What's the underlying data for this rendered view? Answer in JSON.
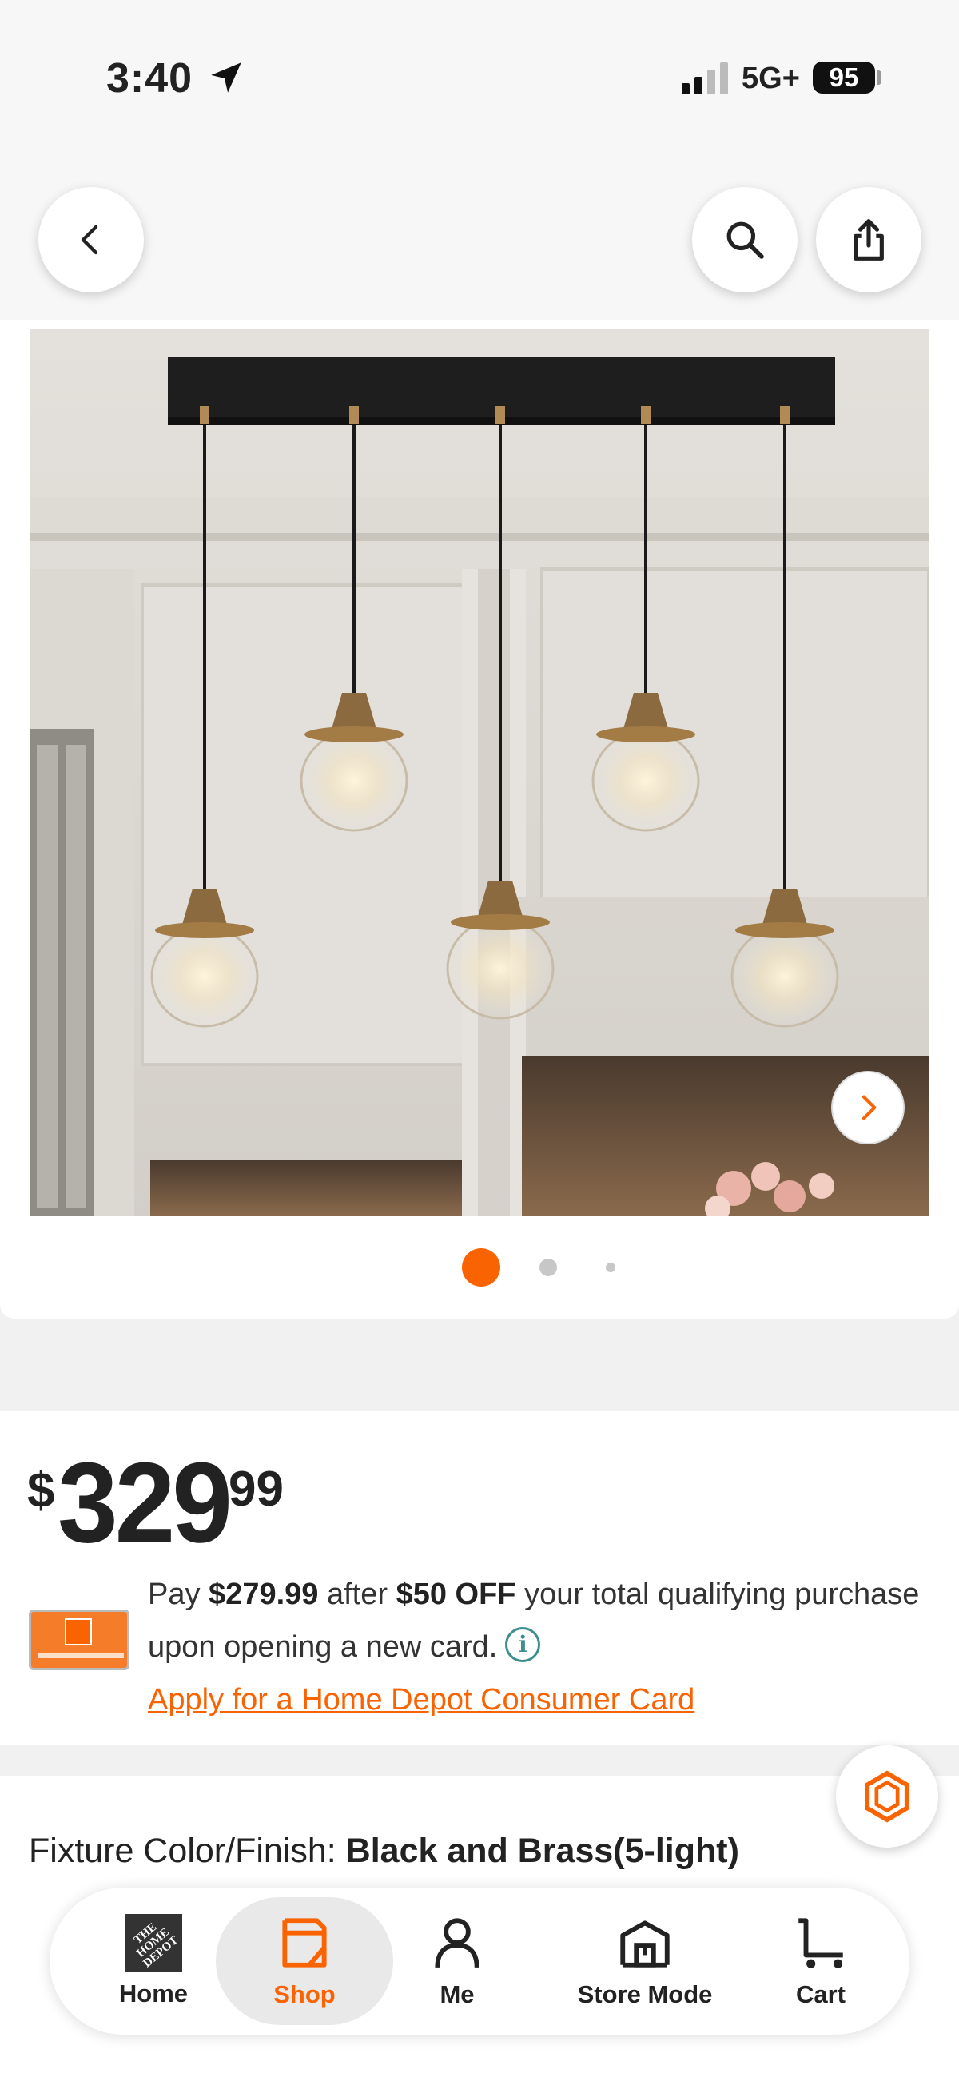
{
  "status_bar": {
    "time": "3:40",
    "network": "5G+",
    "battery": "95",
    "icons": [
      "location-arrow-icon",
      "signal-bars-icon",
      "battery-icon"
    ]
  },
  "top_nav": {
    "icons": [
      "chevron-left-icon",
      "search-icon",
      "share-icon"
    ]
  },
  "gallery": {
    "image_alt": "Black and brass 5-light pendant chandelier with clear glass globes",
    "next_icon": "chevron-right-icon",
    "slide_count": 3,
    "active_slide": 1
  },
  "price": {
    "dollar_sign": "$",
    "whole": "329",
    "cents": "99"
  },
  "promo": {
    "text_pay": "Pay ",
    "sale_price": "$279.99",
    "text_after": " after ",
    "discount": "$50 OFF",
    "text_rest": " your total qualifying purchase upon opening a new card.",
    "info_glyph": "i",
    "apply_link": "Apply for a Home Depot Consumer Card"
  },
  "fixture": {
    "label": "Fixture Color/Finish: ",
    "value": "Black and Brass(5-light)"
  },
  "tab_bar": {
    "home": "Home",
    "home_logo": "THE HOME DEPOT",
    "shop": "Shop",
    "me": "Me",
    "store_mode": "Store Mode",
    "cart": "Cart",
    "active_tab": "Shop"
  },
  "colors": {
    "brand_orange": "#f96302",
    "info_teal": "#3e8e8e"
  }
}
